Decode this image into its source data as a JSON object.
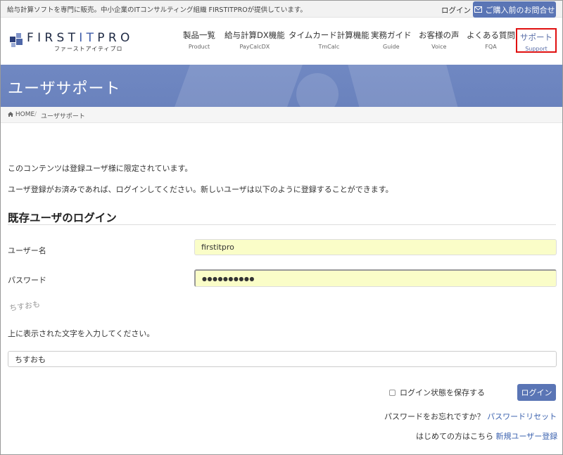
{
  "topbar": {
    "tagline": "給与計算ソフトを専門に販売。中小企業のITコンサルティング組織 FIRSTITPROが提供しています。",
    "login_link": "ログイン",
    "contact_button": "ご購入前のお問合せ",
    "contact_icon": "mail-icon"
  },
  "logo": {
    "name_part1": "FIRST",
    "name_part2": "IT",
    "name_part3": "PRO",
    "kana": "ファーストアイティプロ"
  },
  "nav": [
    {
      "jp": "製品一覧",
      "en": "Product"
    },
    {
      "jp": "給与計算DX機能",
      "en": "PayCalcDX"
    },
    {
      "jp": "タイムカード計算機能",
      "en": "TmCalc"
    },
    {
      "jp": "実務ガイド",
      "en": "Guide"
    },
    {
      "jp": "お客様の声",
      "en": "Voice"
    },
    {
      "jp": "よくある質問",
      "en": "FQA"
    },
    {
      "jp": "サポート",
      "en": "Support"
    }
  ],
  "banner": {
    "title": "ユーザサポート"
  },
  "breadcrumb": {
    "home": "HOME",
    "separator": "/",
    "current": "ユーザサポート",
    "home_icon": "home-icon"
  },
  "content": {
    "notice1": "このコンテンツは登録ユーザ様に限定されています。",
    "notice2": "ユーザ登録がお済みであれば、ログインしてください。新しいユーザは以下のように登録することができます。",
    "section_title": "既存ユーザのログイン",
    "username_label": "ユーザー名",
    "username_value": "firstitpro",
    "password_label": "パスワード",
    "password_value": "●●●●●●●●●●",
    "captcha_text": "ちすおも",
    "captcha_instruction": "上に表示された文字を入力してください。",
    "captcha_value": "ちすおも",
    "remember_label": "ログイン状態を保存する",
    "login_button": "ログイン",
    "forgot_prefix": "パスワードをお忘れですか？",
    "forgot_link": "パスワードリセット",
    "register_prefix": "はじめての方はこちら",
    "register_link": "新規ユーザー登録"
  },
  "colors": {
    "accent": "#5a75b5",
    "banner": "#6d85bf",
    "highlight_border": "#e01010",
    "input_fill": "#fafdc8"
  }
}
